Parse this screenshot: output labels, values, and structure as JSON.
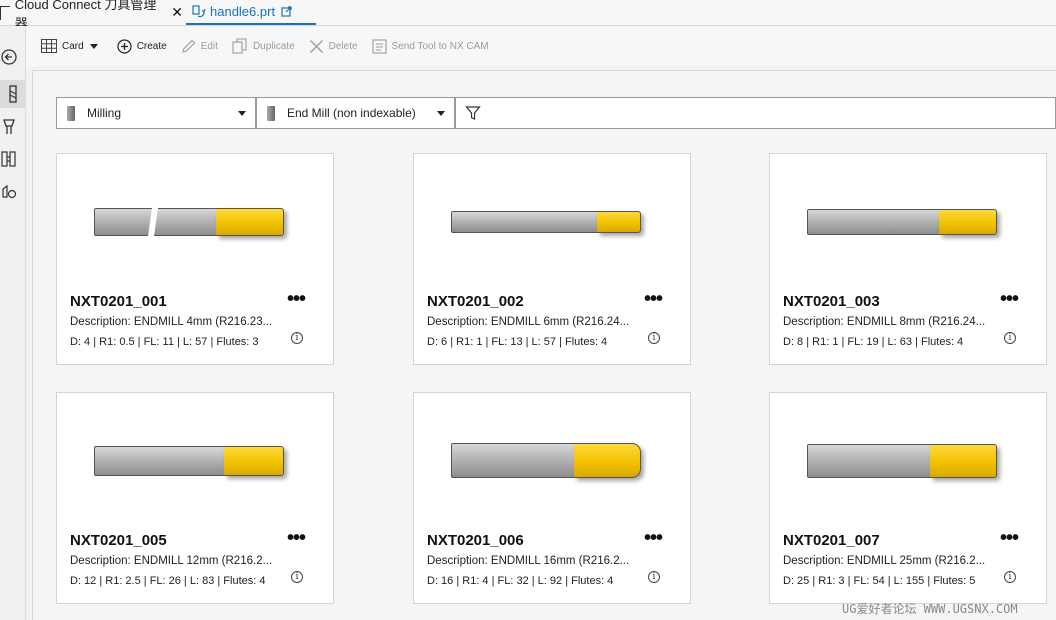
{
  "tabs": [
    {
      "label": "Cloud Connect 刀具管理器",
      "close": "✕"
    },
    {
      "label": "handle6.prt"
    }
  ],
  "toolbar": {
    "view_label": "Card",
    "create_label": "Create",
    "edit_label": "Edit",
    "duplicate_label": "Duplicate",
    "delete_label": "Delete",
    "send_label": "Send Tool to NX CAM"
  },
  "filters": {
    "category": "Milling",
    "type": "End Mill (non indexable)"
  },
  "cards": [
    {
      "name": "NXT0201_001",
      "description": "Description:  ENDMILL 4mm (R216.23...",
      "params": "D: 4 | R1: 0.5 | FL: 11 | L: 57 | Flutes: 3",
      "more": "•••",
      "info": "i"
    },
    {
      "name": "NXT0201_002",
      "description": "Description:  ENDMILL 6mm (R216.24...",
      "params": "D: 6 | R1: 1 | FL: 13 | L: 57 | Flutes: 4",
      "more": "•••",
      "info": "i"
    },
    {
      "name": "NXT0201_003",
      "description": "Description:  ENDMILL 8mm (R216.24...",
      "params": "D: 8 | R1: 1 | FL: 19 | L: 63 | Flutes: 4",
      "more": "•••",
      "info": "i"
    },
    {
      "name": "NXT0201_005",
      "description": "Description:  ENDMILL 12mm (R216.2...",
      "params": "D: 12 | R1: 2.5 | FL: 26 | L: 83 | Flutes: 4",
      "more": "•••",
      "info": "i"
    },
    {
      "name": "NXT0201_006",
      "description": "Description:  ENDMILL 16mm (R216.2...",
      "params": "D: 16 | R1: 4 | FL: 32 | L: 92 | Flutes: 4",
      "more": "•••",
      "info": "i"
    },
    {
      "name": "NXT0201_007",
      "description": "Description:  ENDMILL 25mm (R216.2...",
      "params": "D: 25 | R1: 3 | FL: 54 | L: 155 | Flutes: 5",
      "more": "•••",
      "info": "i"
    }
  ],
  "watermark": "UG爱好者论坛 WWW.UGSNX.COM",
  "colors": {
    "accent": "#1a73b8",
    "flute": "#f2c200",
    "shank": "#a9a9a9"
  }
}
